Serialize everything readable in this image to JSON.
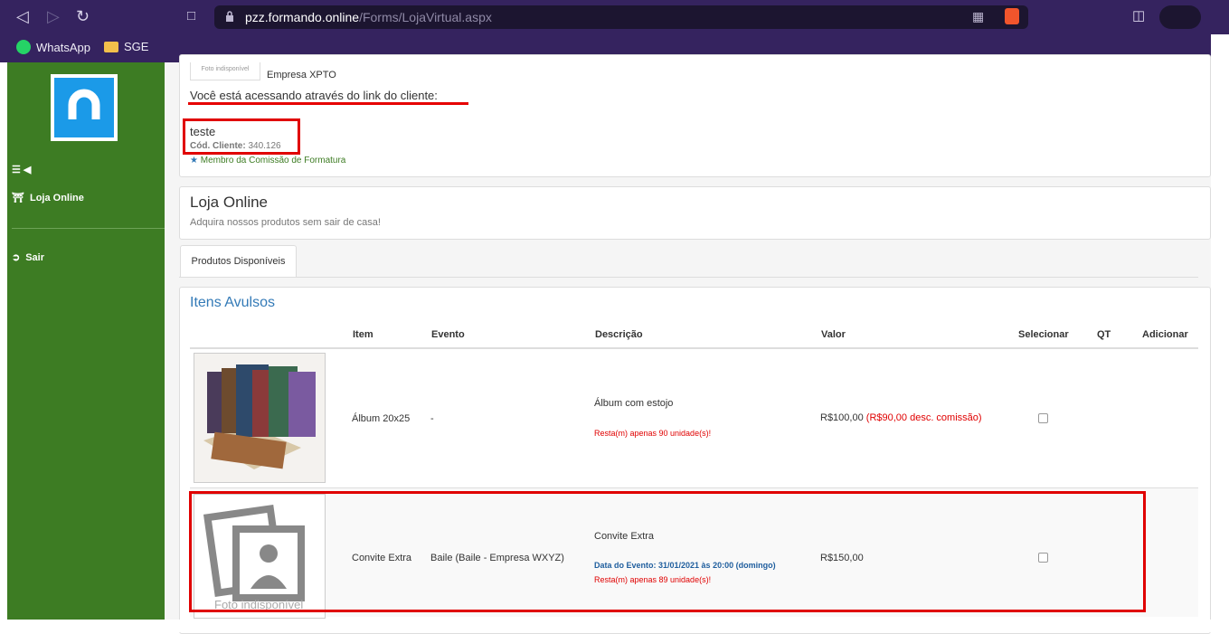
{
  "browser": {
    "url_domain": "pzz.formando.online",
    "url_path": "/Forms/LojaVirtual.aspx",
    "bookmarks": [
      {
        "label": "WhatsApp",
        "icon": "whatsapp-icon"
      },
      {
        "label": "SGE",
        "icon": "folder-icon"
      }
    ]
  },
  "sidebar": {
    "items": [
      {
        "label": "",
        "icon": "menu-toggle-icon"
      },
      {
        "label": "Loja Online",
        "icon": "cart-icon"
      },
      {
        "label": "Sair",
        "icon": "logout-icon"
      }
    ]
  },
  "profile": {
    "photo_caption": "Foto indisponível",
    "company": "Empresa XPTO",
    "access_notice": "Você está acessando através do link do cliente:",
    "client_name": "teste",
    "client_code_label": "Cód. Cliente:",
    "client_code": "340.126",
    "commission_badge": "Membro da Comissão de Formatura"
  },
  "store": {
    "title": "Loja Online",
    "subtitle": "Adquira nossos produtos sem sair de casa!",
    "tab": "Produtos Disponíveis",
    "section_title": "Itens Avulsos"
  },
  "table": {
    "headers": [
      "Item",
      "Evento",
      "Descrição",
      "Valor",
      "Selecionar",
      "QT",
      "Adicionar"
    ],
    "rows": [
      {
        "item": "Álbum 20x25",
        "event": "-",
        "description": "Álbum com estojo",
        "event_date": "",
        "stock": "Resta(m) apenas 90 unidade(s)!",
        "price": "R$100,00",
        "discount": "(R$90,00 desc. comissão)",
        "image": "album-photo"
      },
      {
        "item": "Convite Extra",
        "event": "Baile (Baile - Empresa WXYZ)",
        "description": "Convite Extra",
        "event_date": "Data do Evento: 31/01/2021 às 20:00 (domingo)",
        "stock": "Resta(m) apenas 89 unidade(s)!",
        "price": "R$150,00",
        "discount": "",
        "image_caption": "Foto indisponível"
      }
    ]
  },
  "colors": {
    "browser_bar": "#35235f",
    "sidebar": "#3d7c23",
    "logo": "#1b9ae8",
    "highlight": "#e00000",
    "link_blue": "#337ab7"
  }
}
